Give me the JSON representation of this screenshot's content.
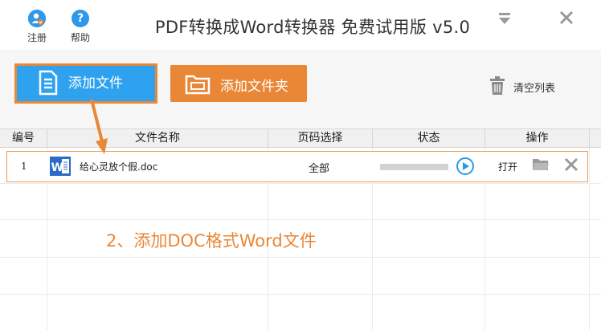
{
  "titlebar": {
    "title": "PDF转换成Word转换器 免费试用版 v5.0",
    "register_label": "注册",
    "help_label": "帮助"
  },
  "toolbar": {
    "add_file_label": "添加文件",
    "add_folder_label": "添加文件夹",
    "clear_list_label": "清空列表"
  },
  "table": {
    "columns": [
      "编号",
      "文件名称",
      "页码选择",
      "状态",
      "操作"
    ],
    "rows": [
      {
        "number": "1",
        "file_name": "给心灵放个假.doc",
        "page_selection": "全部",
        "status_progress": 0,
        "open_label": "打开"
      }
    ]
  },
  "annotation": "2、添加DOC格式Word文件",
  "colors": {
    "accent_orange": "#ea8737",
    "accent_blue": "#2ea2ef",
    "icon_blue": "#2f98e8"
  }
}
